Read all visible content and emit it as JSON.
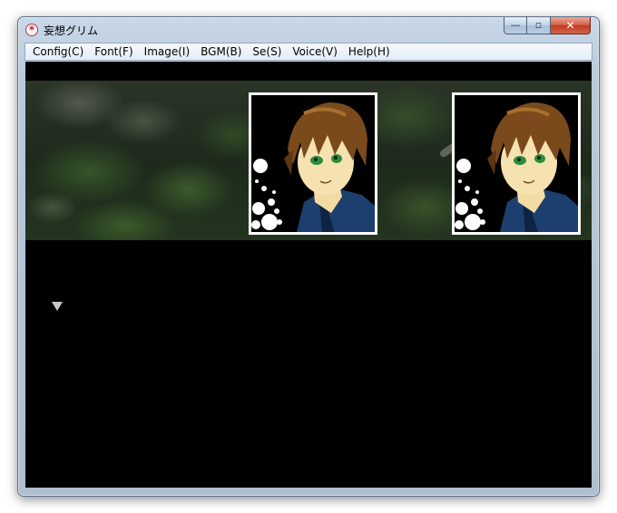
{
  "window": {
    "title": "妄想グリム",
    "icon": "app-asterisk-icon",
    "controls": {
      "minimize_glyph": "—",
      "maximize_glyph": "▫",
      "close_glyph": "✕"
    }
  },
  "menubar": {
    "items": [
      {
        "label": "Config(C)"
      },
      {
        "label": "Font(F)"
      },
      {
        "label": "Image(I)"
      },
      {
        "label": "BGM(B)"
      },
      {
        "label": "Se(S)"
      },
      {
        "label": "Voice(V)"
      },
      {
        "label": "Help(H)"
      }
    ]
  },
  "scene": {
    "background": "mossy-forest-rocks",
    "portraits": [
      {
        "character": "brown-haired-boy",
        "position": "left"
      },
      {
        "character": "brown-haired-boy",
        "position": "right"
      }
    ]
  },
  "message_window": {
    "text": "",
    "indicator_icon": "next-page-triangle-icon"
  },
  "colors": {
    "client_background": "#000000",
    "close_button": "#c23c1f",
    "portrait_frame": "#ffffff",
    "hair": "#7a4a1c",
    "eyes": "#2e8b3c",
    "jacket": "#1d3f6e"
  }
}
